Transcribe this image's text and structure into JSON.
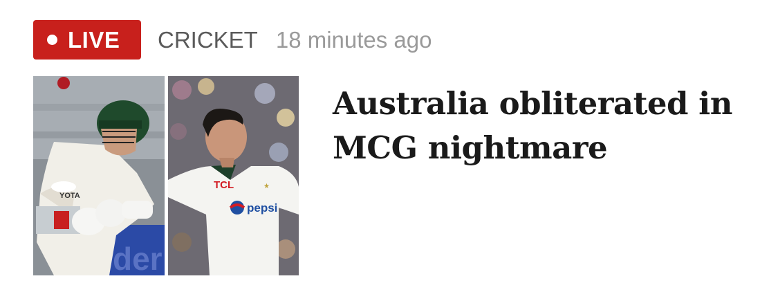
{
  "badge": {
    "label": "LIVE",
    "color": "#c8201c"
  },
  "category": "CRICKET",
  "timestamp": "18 minutes ago",
  "headline": "Australia obliterated in MCG nightmare",
  "images": [
    {
      "name": "photo-batsman"
    },
    {
      "name": "photo-bowler"
    }
  ]
}
